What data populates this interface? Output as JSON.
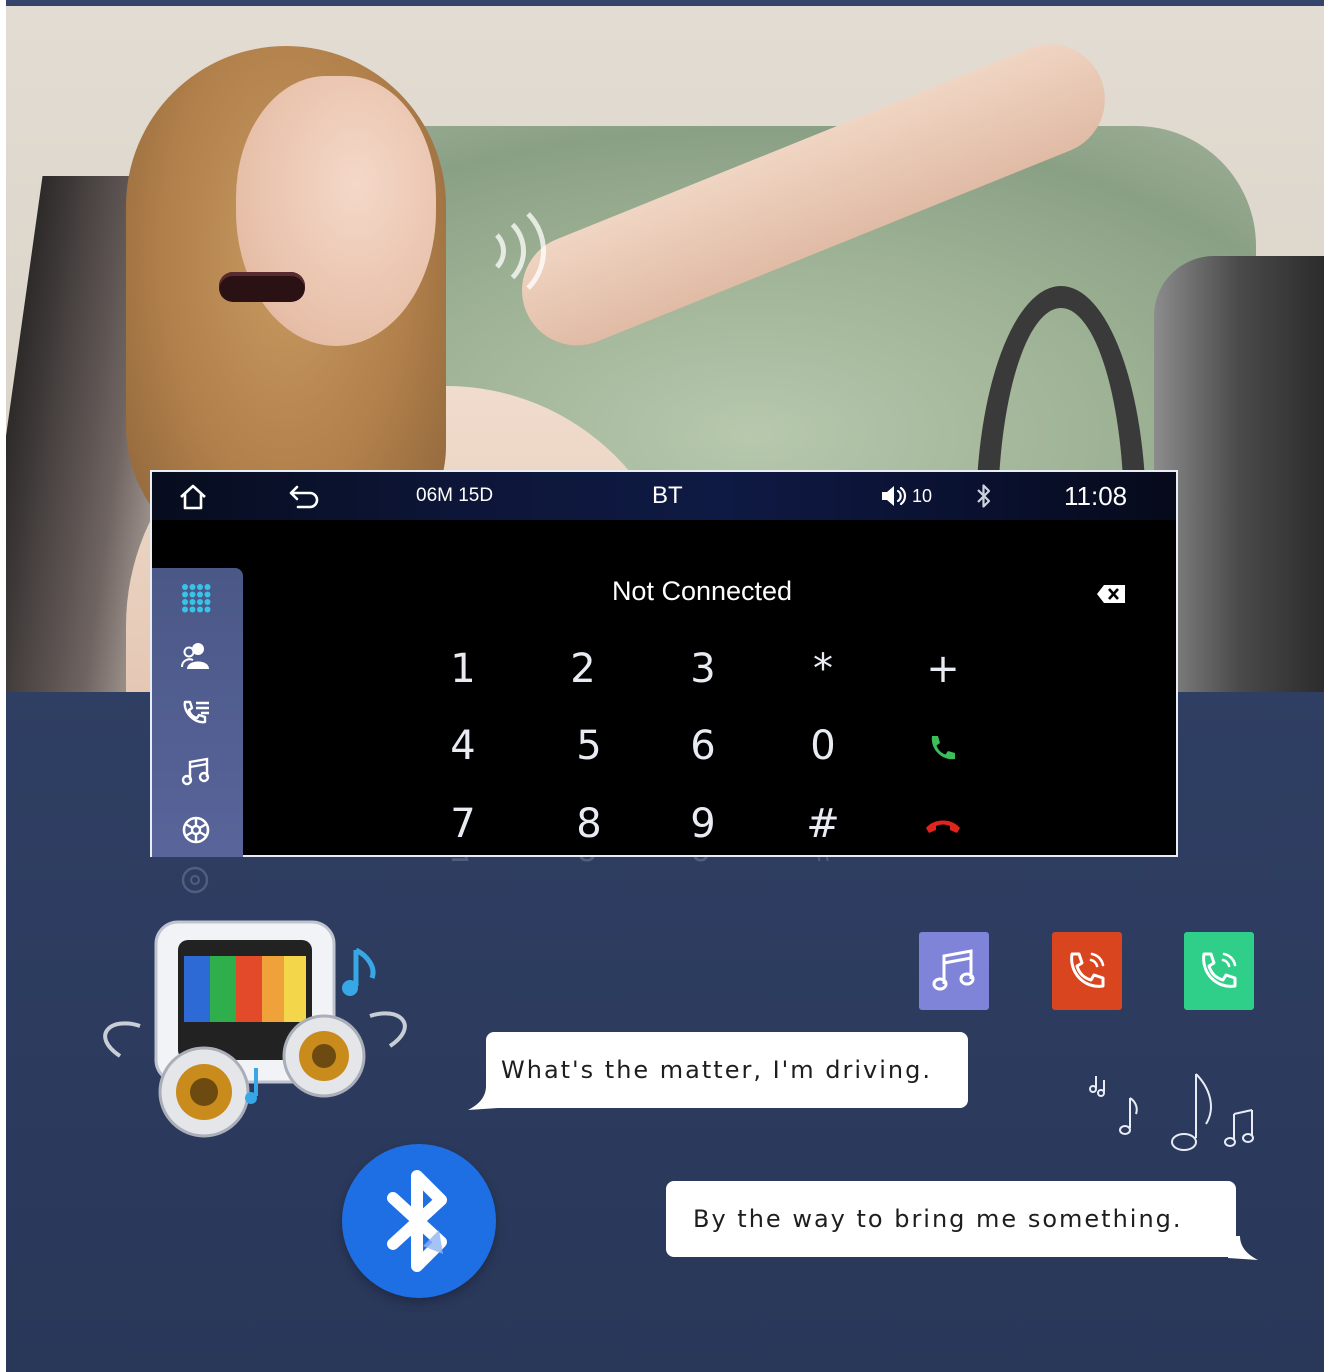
{
  "status_bar": {
    "date": "06M 15D",
    "title": "BT",
    "volume": "10",
    "time": "11:08"
  },
  "dialer": {
    "status": "Not Connected",
    "keys": [
      "1",
      "2",
      "3",
      "*",
      "+",
      "4",
      "5",
      "6",
      "0",
      "7",
      "8",
      "9",
      "#"
    ]
  },
  "sidebar": {
    "items": [
      "keypad-icon",
      "contacts-icon",
      "call-log-icon",
      "music-icon",
      "settings-icon"
    ]
  },
  "colors": {
    "background": "#2f3f63",
    "sidebar": "#4f5c8f",
    "call_green": "#3cbf5a",
    "hangup_red": "#e0251f",
    "keypad_dot": "#37c4e8",
    "music_tile": "#7f84d8",
    "phone_tile_red": "#d8451e",
    "phone_tile_green": "#2fcf8a",
    "bluetooth_blue": "#1f6fe4"
  },
  "bubbles": {
    "first": "What's the matter, I'm driving.",
    "second": "By the way to bring me something."
  }
}
